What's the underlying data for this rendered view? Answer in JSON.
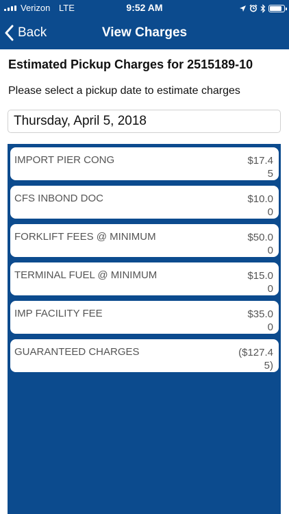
{
  "status_bar": {
    "carrier": "Verizon",
    "network": "LTE",
    "time": "9:52 AM",
    "battery_level": 0.85
  },
  "nav": {
    "back_label": "Back",
    "title": "View Charges"
  },
  "content": {
    "heading": "Estimated Pickup Charges for 2515189-10",
    "instruction": "Please select a pickup date to estimate charges",
    "selected_date": "Thursday, April 5, 2018"
  },
  "charges": [
    {
      "name": "IMPORT PIER CONG",
      "amount": "$17.45"
    },
    {
      "name": "CFS INBOND DOC",
      "amount": "$10.00"
    },
    {
      "name": "FORKLIFT FEES @ MINIMUM",
      "amount": "$50.00"
    },
    {
      "name": "TERMINAL FUEL @ MINIMUM",
      "amount": "$15.00"
    },
    {
      "name": "IMP FACILITY FEE",
      "amount": "$35.00"
    },
    {
      "name": "GUARANTEED CHARGES",
      "amount": "($127.45)"
    }
  ],
  "colors": {
    "brand_blue": "#0c4b8e",
    "card_background": "#ffffff",
    "card_text": "#555555"
  },
  "icons": {
    "signal": "signal-bars-icon",
    "location": "location-arrow-icon",
    "alarm": "alarm-clock-icon",
    "bluetooth": "bluetooth-icon",
    "battery": "battery-icon",
    "back": "chevron-left-icon"
  }
}
